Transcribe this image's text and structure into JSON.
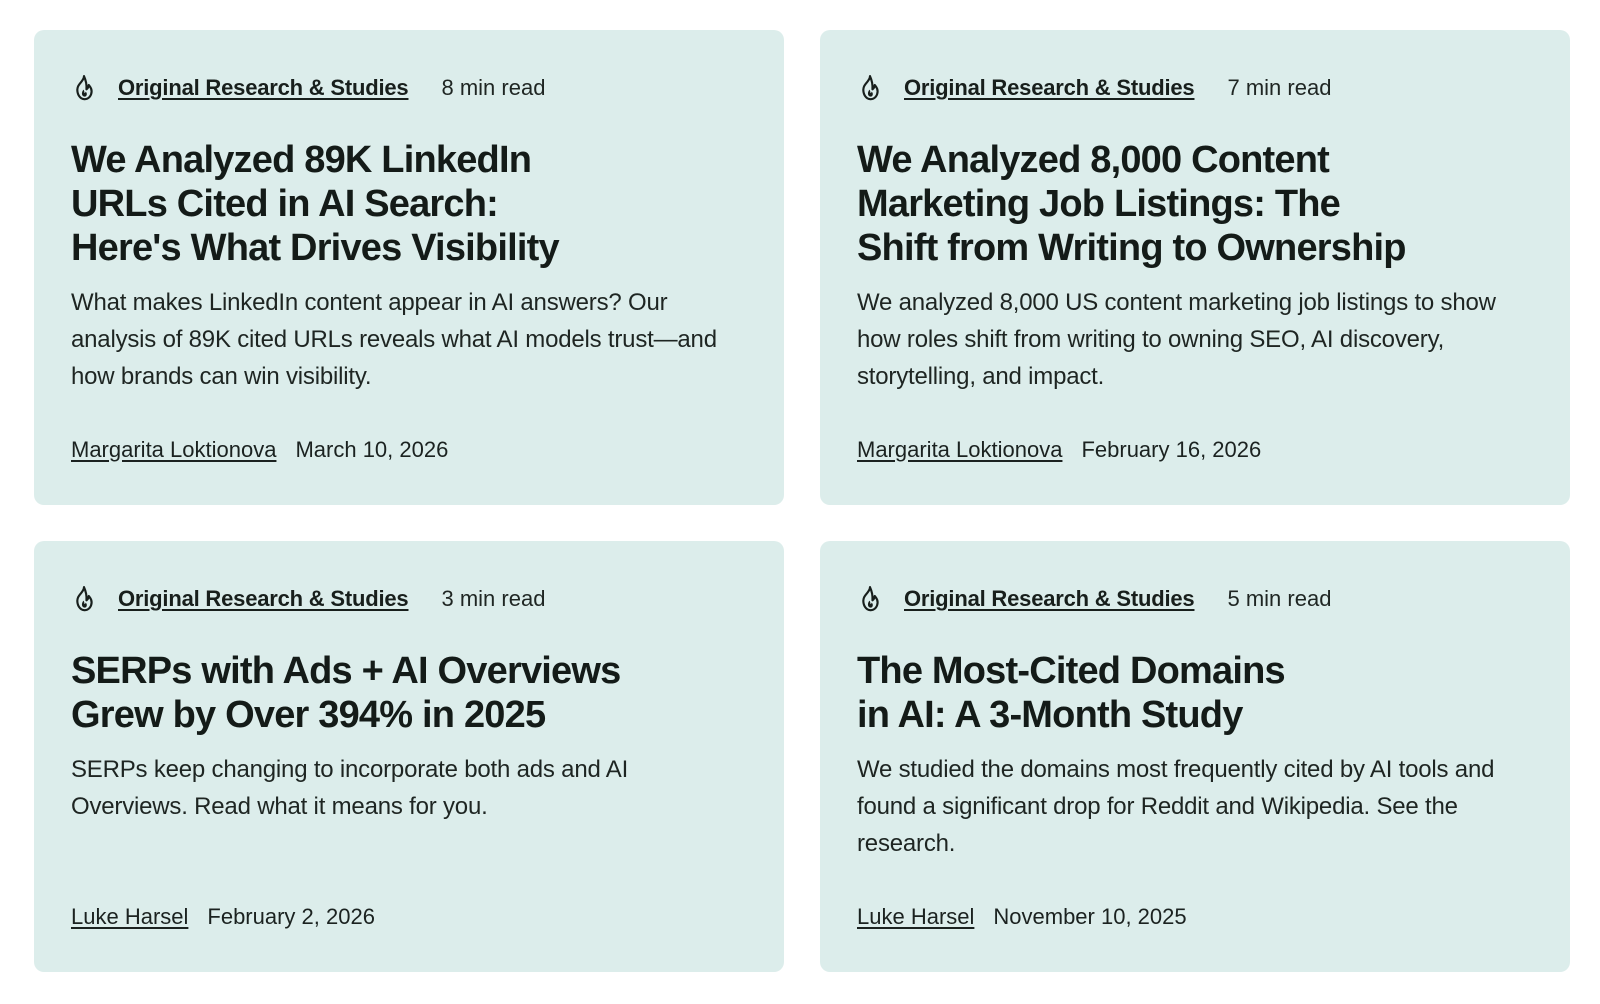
{
  "cards": [
    {
      "category": "Original Research & Studies",
      "read_time": "8 min read",
      "title_lines": [
        "We Analyzed 89K LinkedIn",
        "URLs Cited in AI Search:",
        "Here's What Drives Visibility"
      ],
      "summary": "What makes LinkedIn content appear in AI answers? Our analysis of 89K cited URLs reveals what AI models trust—and how brands can win visibility.",
      "author": "Margarita Loktionova",
      "date": "March 10, 2026"
    },
    {
      "category": "Original Research & Studies",
      "read_time": "7 min read",
      "title_lines": [
        "We Analyzed 8,000 Content",
        "Marketing Job Listings: The",
        "Shift from Writing to Ownership"
      ],
      "summary": "We analyzed 8,000 US content marketing job listings to show how roles shift from writing to owning SEO, AI discovery, storytelling, and impact.",
      "author": "Margarita Loktionova",
      "date": "February 16, 2026"
    },
    {
      "category": "Original Research & Studies",
      "read_time": "3 min read",
      "title_lines": [
        "SERPs with Ads + AI Overviews",
        "Grew by Over 394% in 2025"
      ],
      "summary": "SERPs keep changing to incorporate both ads and AI Overviews. Read what it means for you.",
      "author": "Luke Harsel",
      "date": "February 2, 2026"
    },
    {
      "category": "Original Research & Studies",
      "read_time": "5 min read",
      "title_lines": [
        "The Most-Cited Domains",
        "in AI: A 3-Month Study"
      ],
      "summary": "We studied the domains most frequently cited by AI tools and found a significant drop for Reddit and Wikipedia. See the research.",
      "author": "Luke Harsel",
      "date": "November 10, 2025"
    }
  ],
  "icons": {
    "category_icon": "flame-icon"
  },
  "colors": {
    "card_background": "#dcedeb",
    "text": "#181f1c"
  }
}
